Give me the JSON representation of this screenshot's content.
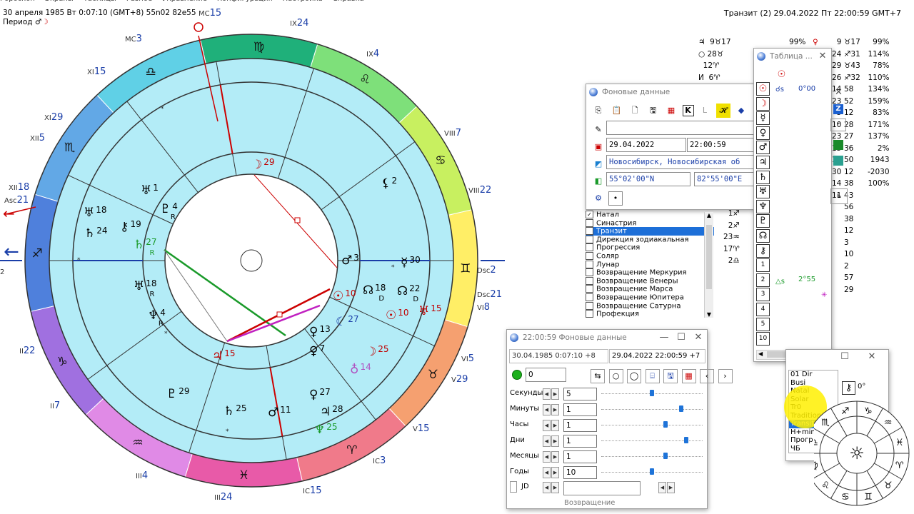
{
  "menu": [
    "Гороскоп",
    "Экраны",
    "Таблицы",
    "Разное",
    "Управление",
    "Конфигурация",
    "Настройка",
    "Справка"
  ],
  "natal_header": "30 апреля 1985  Вт   0:07:10 (GMT+8) 55n02  82e55",
  "period_label": "Период",
  "transit_header": "Транзит (2) 29.04.2022  Пт 22:00:59 GMT+7",
  "chart": {
    "signs": [
      "♈",
      "♉",
      "♊",
      "♋",
      "♌",
      "♍",
      "♎",
      "♏",
      "♐",
      "♑",
      "♒",
      "♓"
    ],
    "angle_labels": {
      "mc_top": "MC15",
      "ix_top": "IX24",
      "ix2": "IX4",
      "viii": "VIII7",
      "viii2": "VIII22",
      "dsc": "Dsc2",
      "dsc2": "Dsc21",
      "vi": "VI8",
      "vi2": "VI5",
      "v": "V29",
      "v2": "V15",
      "ic": "IC3",
      "ic2": "IC15",
      "iii": "III24",
      "iii2": "III4",
      "ii": "II7",
      "ii2": "II22",
      "asc": "Asc21",
      "asc_deg": "2",
      "xii": "XII18",
      "xii2": "XII5",
      "xi": "XI29",
      "xi2": "XI15",
      "mc2": "MC3"
    },
    "outer_planets": [
      {
        "g": "☽",
        "deg": "29",
        "color": "#c00000"
      },
      {
        "g": "⚸",
        "deg": "2",
        "color": "#000"
      },
      {
        "g": "♂",
        "deg": "3",
        "color": "#000",
        "extra": "♁7"
      },
      {
        "g": "☿",
        "deg": "30",
        "color": "#000"
      },
      {
        "g": "☊",
        "deg": "18",
        "color": "#000",
        "sub": "D"
      },
      {
        "g": "☊",
        "deg": "22",
        "color": "#000",
        "sub": "D"
      },
      {
        "g": "☉",
        "deg": "10",
        "color": "#c00000"
      },
      {
        "g": "☉",
        "deg": "10",
        "color": "#c00000"
      },
      {
        "g": "♅",
        "deg": "15",
        "color": "#c00000"
      },
      {
        "g": "☾",
        "deg": "27",
        "color": "#1a3ea8"
      },
      {
        "g": "☽",
        "deg": "25",
        "color": "#c00000"
      },
      {
        "g": "♁",
        "deg": "14",
        "color": "#b050c0"
      },
      {
        "g": "♀",
        "deg": "13",
        "color": "#000"
      },
      {
        "g": "♀",
        "deg": "7",
        "color": "#000"
      },
      {
        "g": "♀",
        "deg": "27",
        "color": "#000"
      },
      {
        "g": "♃",
        "deg": "28",
        "color": "#000"
      },
      {
        "g": "♆",
        "deg": "25",
        "color": "#1a9a2a"
      },
      {
        "g": "♂",
        "deg": "11",
        "color": "#000"
      },
      {
        "g": "♄",
        "deg": "25",
        "color": "#000"
      },
      {
        "g": "♇",
        "deg": "29",
        "color": "#000"
      },
      {
        "g": "♃",
        "deg": "15",
        "color": "#c00000"
      },
      {
        "g": "♆",
        "deg": "4",
        "color": "#000",
        "sub": "R"
      },
      {
        "g": "♅",
        "deg": "18",
        "color": "#000",
        "sub": "R"
      },
      {
        "g": "♄",
        "deg": "27",
        "color": "#1a9a2a",
        "sub": "R"
      },
      {
        "g": "♇",
        "deg": "4",
        "color": "#000",
        "sub": "R"
      },
      {
        "g": "⚷",
        "deg": "19",
        "color": "#000"
      },
      {
        "g": "♅",
        "deg": "1",
        "color": "#000"
      },
      {
        "g": "♅",
        "deg": "18",
        "color": "#000"
      },
      {
        "g": "♄",
        "deg": "24",
        "color": "#000"
      }
    ]
  },
  "right_columns": {
    "col1": [
      "♃  9♉17",
      "○ 28♉",
      "  12♈",
      "И  6♈",
      "",
      "",
      "",
      "",
      "",
      "",
      "",
      "",
      "",
      "1♐",
      "2♐",
      "23♒",
      "17♈",
      "2♎"
    ],
    "col_pct": [
      "99%",
      "114%",
      "78%",
      "110%",
      "134%",
      "159%",
      "83%",
      "171%",
      "137%",
      "2%",
      "1943",
      "-2030",
      "100%"
    ],
    "col_gl": [
      "♉17",
      "♐31",
      "♉43",
      "♐32",
      "58",
      "52",
      "12",
      "28",
      "27",
      "36",
      "50",
      "12",
      "38",
      "43",
      "56",
      "38",
      "12",
      "3",
      "10",
      "2",
      "57",
      "29"
    ],
    "col_deg": [
      "9",
      "24",
      "29",
      "26",
      "14",
      "23",
      "5",
      "10",
      "23",
      "15",
      "15",
      "30",
      "14",
      "11",
      "21",
      "3",
      "14",
      "4",
      "14"
    ]
  },
  "fon_window": {
    "title": "Фоновые данные",
    "date": "29.04.2022",
    "time": "22:00:59",
    "place": "Новосибирск, Новосибирская об",
    "lat": "55°02'00\"N",
    "lon": "82°55'00\"E"
  },
  "layer_list": [
    {
      "label": "Натал",
      "checked": true
    },
    {
      "label": "Синастрия",
      "checked": false
    },
    {
      "label": "Транзит",
      "checked": true,
      "selected": true
    },
    {
      "label": "Дирекция зодиакальная",
      "checked": false
    },
    {
      "label": "Прогрессия",
      "checked": false
    },
    {
      "label": "Соляр",
      "checked": false
    },
    {
      "label": "Лунар",
      "checked": false
    },
    {
      "label": "Возвращение Меркурия",
      "checked": false
    },
    {
      "label": "Возвращение Венеры",
      "checked": false
    },
    {
      "label": "Возвращение Марса",
      "checked": false
    },
    {
      "label": "Возвращение Юпитера",
      "checked": false
    },
    {
      "label": "Возвращение Сатурна",
      "checked": false
    },
    {
      "label": "Профекция",
      "checked": false
    }
  ],
  "aspect_table": {
    "title": "Таблица ...",
    "rows": [
      "☉",
      "☽",
      "☿",
      "♀",
      "♂",
      "♃",
      "♄",
      "♅",
      "♆",
      "♇",
      "☊",
      "⚷",
      "1",
      "2",
      "3",
      "4",
      "5",
      "10"
    ],
    "cell_sun": "0°00",
    "cell_asc": "2°55",
    "col_head": "☉"
  },
  "time_window": {
    "title": "22:00:59 Фоновые данные",
    "natal": "30.04.1985   0:07:10  +8",
    "transit": "29.04.2022   22:00:59  +7",
    "counter": "0",
    "rows": [
      {
        "label": "Секунды",
        "value": "5",
        "knob": 0.48
      },
      {
        "label": "Минуты",
        "value": "1",
        "knob": 0.77
      },
      {
        "label": "Часы",
        "value": "1",
        "knob": 0.61
      },
      {
        "label": "Дни",
        "value": "1",
        "knob": 0.82
      },
      {
        "label": "Месяцы",
        "value": "1",
        "knob": 0.61
      },
      {
        "label": "Годы",
        "value": "10",
        "knob": 0.48
      }
    ],
    "jd_label": "JD",
    "footer": "Возвращение"
  },
  "systems_window": {
    "items": [
      "01 Dir",
      "Busi",
      "Natal",
      "Solar",
      "Tr0",
      "Traditional",
      "Transit",
      "H+min",
      "Прогр",
      "ЧБ"
    ],
    "selected": "Transit",
    "deg": "0°"
  }
}
